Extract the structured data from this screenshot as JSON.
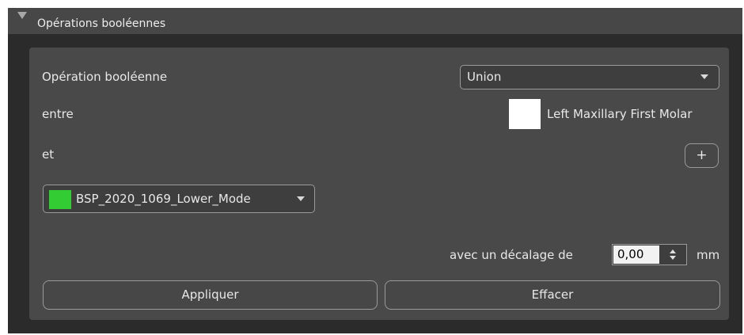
{
  "panel": {
    "title": "Opérations booléennes"
  },
  "form": {
    "operation_label": "Opération booléenne",
    "operation_value": "Union",
    "between_label": "entre",
    "first_object": "Left Maxillary First Molar",
    "and_label": "et",
    "add_symbol": "+",
    "second_object": "BSP_2020_1069_Lower_Mode",
    "offset_label": "avec un décalage de",
    "offset_value": "0,00",
    "offset_unit": "mm"
  },
  "buttons": {
    "apply_label": "Appliquer",
    "clear_label": "Effacer"
  },
  "colors": {
    "first_object": "#ffffff",
    "second_object": "#33cc33"
  }
}
